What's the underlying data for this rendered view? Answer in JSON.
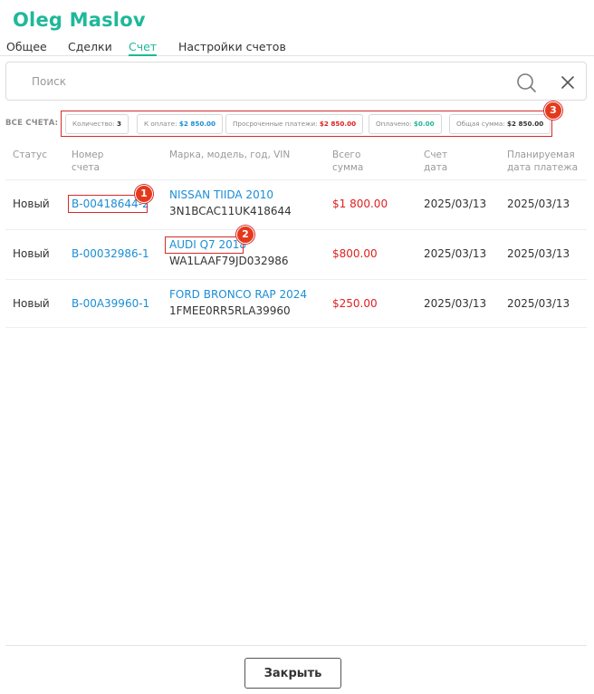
{
  "header": {
    "title": "Oleg Maslov"
  },
  "tabs": [
    {
      "label": "Общее"
    },
    {
      "label": "Сделки"
    },
    {
      "label": "Счет"
    },
    {
      "label": "Настройки счетов"
    }
  ],
  "search": {
    "placeholder": "Поиск",
    "value": ""
  },
  "summary": {
    "label": "ВСЕ СЧЕТА:",
    "chips": [
      {
        "label": "Количество:",
        "value": "3"
      },
      {
        "label": "К оплате:",
        "value": "$2 850.00"
      },
      {
        "label": "Просроченные платежи:",
        "value": "$2 850.00"
      },
      {
        "label": "Оплачено:",
        "value": "$0.00"
      },
      {
        "label": "Общая сумма:",
        "value": "$2 850.00"
      }
    ]
  },
  "table": {
    "headers": [
      {
        "line1": "Статус",
        "line2": ""
      },
      {
        "line1": "Номер",
        "line2": "счета"
      },
      {
        "line1": "Марка, модель, год, VIN",
        "line2": ""
      },
      {
        "line1": "Всего",
        "line2": "сумма"
      },
      {
        "line1": "Счет",
        "line2": "дата"
      },
      {
        "line1": "Планируемая",
        "line2": "дата платежа"
      }
    ],
    "rows": [
      {
        "status": "Новый",
        "number": "B-00418644-2",
        "vehicle": "NISSAN TIIDA 2010",
        "vin": "3N1BCAC11UK418644",
        "amount": "$1 800.00",
        "invoice_date": "2025/03/13",
        "due_date": "2025/03/13"
      },
      {
        "status": "Новый",
        "number": "B-00032986-1",
        "vehicle": "AUDI Q7 2018",
        "vin": "WA1LAAF79JD032986",
        "amount": "$800.00",
        "invoice_date": "2025/03/13",
        "due_date": "2025/03/13"
      },
      {
        "status": "Новый",
        "number": "B-00A39960-1",
        "vehicle": "FORD BRONCO RAP 2024",
        "vin": "1FMEE0RR5RLA39960",
        "amount": "$250.00",
        "invoice_date": "2025/03/13",
        "due_date": "2025/03/13"
      }
    ]
  },
  "annotations": {
    "badge1": "1",
    "badge2": "2",
    "badge3": "3"
  },
  "footer": {
    "close_label": "Закрыть"
  },
  "colors": {
    "accent": "#1fb89a",
    "link": "#1b8ed6",
    "amount": "#e01f1f",
    "annotation": "#e5391c"
  }
}
